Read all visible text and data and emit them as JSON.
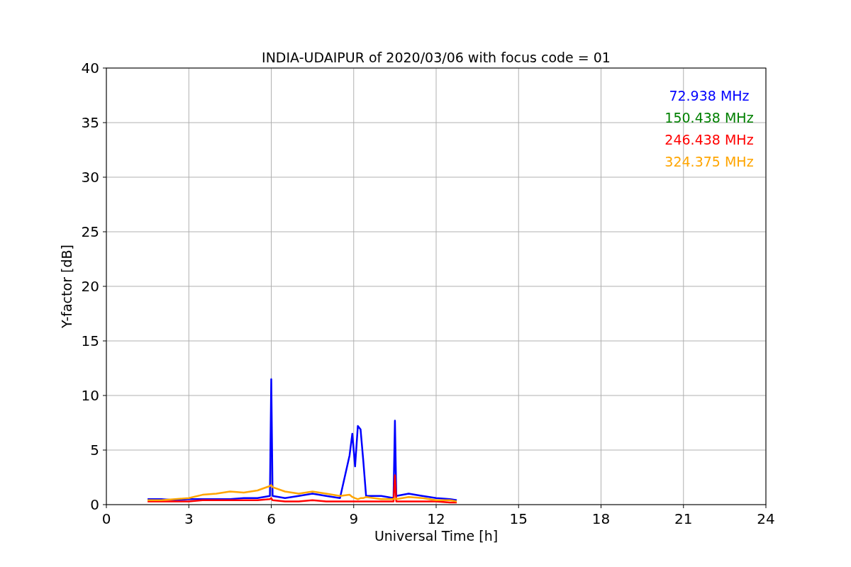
{
  "figure": {
    "chart_data": {
      "type": "line",
      "grid": true,
      "title": "INDIA-UDAIPUR of 2020/03/06 with focus code = 01",
      "xlabel": "Universal Time [h]",
      "ylabel": "Y-factor [dB]",
      "xlim": [
        0,
        24
      ],
      "ylim": [
        0,
        40
      ],
      "xticks": [
        0,
        3,
        6,
        9,
        12,
        15,
        18,
        21,
        24
      ],
      "yticks": [
        0,
        5,
        10,
        15,
        20,
        25,
        30,
        35,
        40
      ],
      "x": [
        1.5,
        2,
        2.5,
        3,
        3.5,
        4,
        4.5,
        5,
        5.5,
        5.95,
        6.0,
        6.05,
        6.5,
        7,
        7.5,
        8,
        8.5,
        8.85,
        8.95,
        9.05,
        9.15,
        9.25,
        9.35,
        9.45,
        10,
        10.45,
        10.5,
        10.55,
        11,
        11.5,
        12,
        12.5,
        12.75
      ],
      "series": [
        {
          "name": "72.938 MHz",
          "color": "#0000ff",
          "values": [
            0.5,
            0.5,
            0.4,
            0.5,
            0.5,
            0.5,
            0.5,
            0.6,
            0.6,
            0.8,
            11.5,
            0.8,
            0.6,
            0.8,
            1.0,
            0.8,
            0.6,
            4.5,
            6.5,
            3.5,
            7.2,
            6.9,
            4.0,
            0.8,
            0.8,
            0.6,
            7.7,
            0.8,
            1.0,
            0.8,
            0.6,
            0.5,
            0.4
          ]
        },
        {
          "name": "150.438 MHz",
          "color": "#008000",
          "values": [
            null,
            null,
            null,
            null,
            null,
            null,
            null,
            null,
            null,
            null,
            null,
            null,
            null,
            null,
            null,
            null,
            null,
            null,
            null,
            null,
            null,
            null,
            null,
            null,
            null,
            null,
            null,
            null,
            null,
            null,
            null,
            null,
            null
          ]
        },
        {
          "name": "246.438 MHz",
          "color": "#ff0000",
          "values": [
            0.3,
            0.3,
            0.3,
            0.3,
            0.4,
            0.4,
            0.4,
            0.4,
            0.4,
            0.5,
            0.6,
            0.4,
            0.3,
            0.3,
            0.4,
            0.3,
            0.3,
            0.3,
            0.3,
            0.3,
            0.3,
            0.3,
            0.3,
            0.3,
            0.3,
            0.3,
            2.7,
            0.3,
            0.3,
            0.3,
            0.3,
            0.2,
            0.2
          ]
        },
        {
          "name": "324.375 MHz",
          "color": "#ffa500",
          "values": [
            0.4,
            0.4,
            0.5,
            0.6,
            0.9,
            1.0,
            1.2,
            1.1,
            1.3,
            1.7,
            1.8,
            1.6,
            1.2,
            1.0,
            1.2,
            1.0,
            0.8,
            0.9,
            0.7,
            0.6,
            0.5,
            0.6,
            0.6,
            0.7,
            0.5,
            0.5,
            0.6,
            0.5,
            0.7,
            0.6,
            0.4,
            0.4,
            0.3
          ]
        }
      ]
    }
  }
}
